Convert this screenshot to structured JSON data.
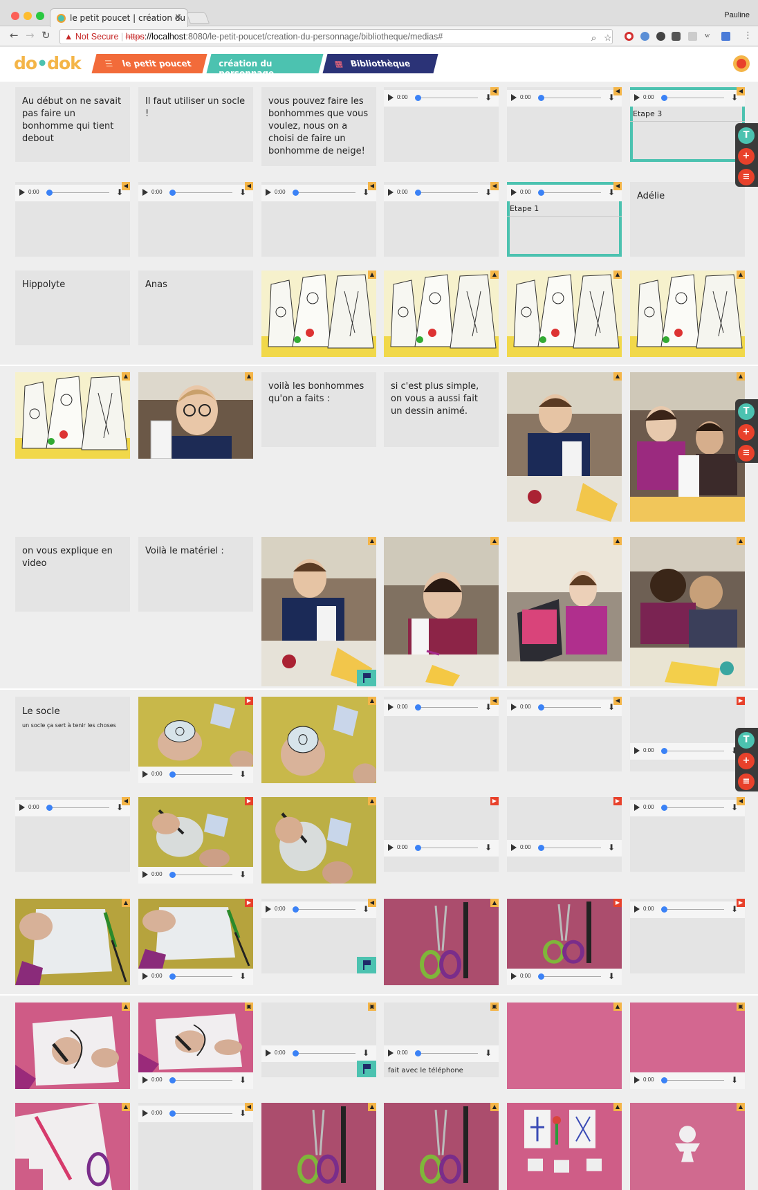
{
  "browser": {
    "tab_title": "le petit poucet | création du pe",
    "profile": "Pauline",
    "url_warning": "Not Secure",
    "url_scheme": "https",
    "url_host": "://localhost",
    "url_path": ":8080/le-petit-poucet/creation-du-personnage/bibliotheque/medias#"
  },
  "app": {
    "logo_a": "do",
    "logo_b": "•",
    "logo_c": "dok",
    "breadcrumbs": [
      {
        "label": "le petit poucet",
        "icon": "list-icon",
        "color": "#f26b3a"
      },
      {
        "label": "création du personnage",
        "icon": "none",
        "color": "#4cc2b0"
      },
      {
        "label": "Bibliothèque",
        "icon": "grid-icon",
        "color": "#2b3377"
      }
    ]
  },
  "player": {
    "time": "0:00"
  },
  "cards": [
    {
      "type": "text",
      "text": "Au début on ne savait pas faire un bonhomme qui tient debout"
    },
    {
      "type": "text",
      "text": "Il faut utiliser un socle !"
    },
    {
      "type": "text",
      "text": "vous pouvez faire les bonhommes que vous voulez, nous on a choisi de faire un bonhomme de neige!"
    },
    {
      "type": "text",
      "text": "Hippolyte"
    },
    {
      "type": "text",
      "text": "Anas"
    },
    {
      "type": "text",
      "text": "Adélie"
    },
    {
      "type": "text",
      "text": "voilà les bonhommes qu'on a faits :"
    },
    {
      "type": "text",
      "text": "si c'est plus simple, on vous a aussi fait un dessin animé."
    },
    {
      "type": "text",
      "text": "on vous explique en video"
    },
    {
      "type": "text",
      "text": "Voilà le matériel :"
    },
    {
      "type": "text",
      "text": "Le socle",
      "sub": "un socle ça sert à tenir les choses"
    }
  ],
  "captions": {
    "etape_3": "Etape 3",
    "etape_1": "Etape 1",
    "telephone": "fait avec le téléphone"
  },
  "colors": {
    "accent": "#4cc2b0",
    "orange": "#f26b3a",
    "navy": "#2b3377",
    "yellow": "#f4b548",
    "red": "#e8412b"
  }
}
